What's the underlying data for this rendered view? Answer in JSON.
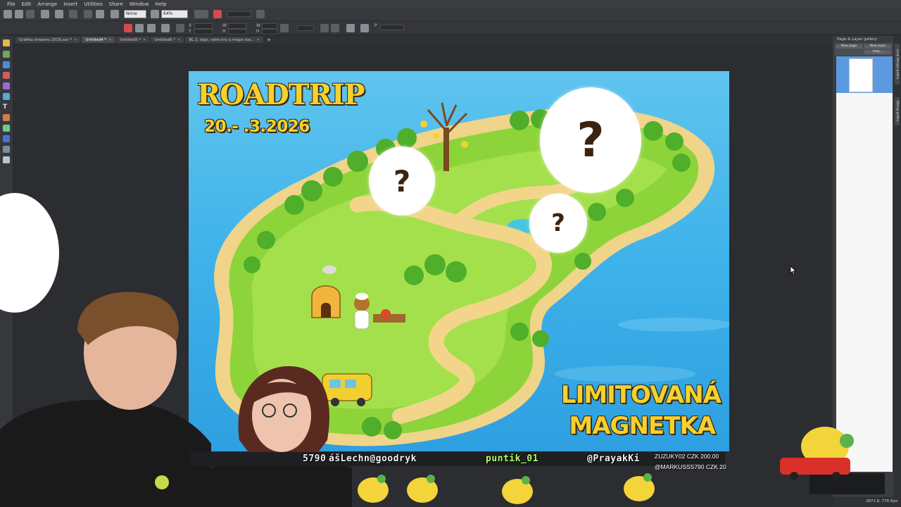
{
  "menu": {
    "items": [
      "File",
      "Edit",
      "Arrange",
      "Insert",
      "Utilities",
      "Share",
      "Window",
      "Help"
    ]
  },
  "toolbar": {
    "quality_value": "None",
    "zoom_value": "64%"
  },
  "tabs": [
    {
      "label": "Grafika streamu 2025.xar *"
    },
    {
      "label": "Untitled4 *"
    },
    {
      "label": "Untitled5 *"
    },
    {
      "label": "Untitled6 *"
    },
    {
      "label": "BL 2, lego, retro hry a mapa roa..."
    }
  ],
  "right_panel": {
    "title": "Page & Layer gallery",
    "button_new_page": "New page",
    "button_new_layer": "New layer",
    "button_help": "Help...",
    "side_tabs": [
      "Local Designs gallery",
      "Bitmap gallery"
    ]
  },
  "poster": {
    "title": "ROADTRIP",
    "date": "20.-   .3.2026",
    "bottom_line1": "LIMITOVANÁ",
    "bottom_line2": "MAGNETKA",
    "questions": [
      "?",
      "?",
      "?"
    ]
  },
  "overlay": {
    "ticker_left": "ášLechn@goodryk",
    "ticker_left_prefix": "5790",
    "ticker_mid": "puntik_01",
    "ticker_right": "@PrayakKi",
    "donation1": "ZUZUKY02   CZK 200.00",
    "donation2": "@MARKUSSS790   CZK 20"
  },
  "statusbar": {
    "coords": "3871.8, 776.6px"
  },
  "colors": {
    "poster_title": "#f6d12e",
    "sea": "#3eb2ea",
    "island": "#8dd43a",
    "path": "#f2d58b",
    "app_bg": "#2b2d30"
  }
}
